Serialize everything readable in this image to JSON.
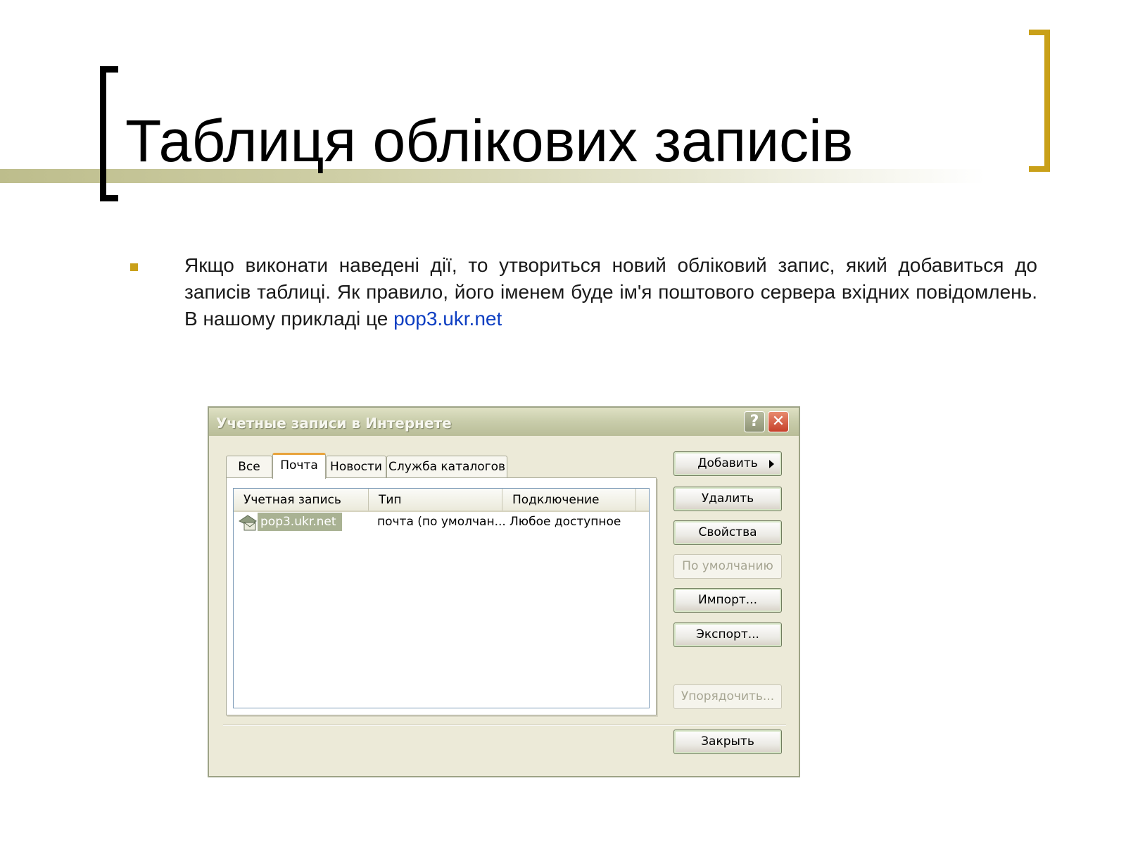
{
  "slide": {
    "title": "Таблиця облікових записів",
    "bullet_text": "Якщо виконати наведені дії, то утвориться новий обліковий запис, який добавиться до записів таблиці. Як правило, його іменем буде ім'я поштового сервера вхідних повідомлень. В нашому прикладі це ",
    "bullet_link": "pop3.ukr.net",
    "colors": {
      "accent": "#c9a019",
      "band": "#bdbd8c",
      "link": "#0d3ec2"
    }
  },
  "dialog": {
    "title": "Учетные записи в Интернете",
    "help_label": "?",
    "close_label": "✕",
    "tabs": [
      "Все",
      "Почта",
      "Новости",
      "Служба каталогов"
    ],
    "active_tab": "Почта",
    "columns": [
      "Учетная запись",
      "Тип",
      "Подключение"
    ],
    "rows": [
      {
        "account": "pop3.ukr.net",
        "type": "почта (по умолчан...",
        "connection": "Любое доступное",
        "icon": "mail-account-icon",
        "selected": true
      }
    ],
    "buttons": {
      "add": "Добавить",
      "delete": "Удалить",
      "properties": "Свойства",
      "set_default": "По умолчанию",
      "import": "Импорт...",
      "export": "Экспорт...",
      "order": "Упорядочить...",
      "close": "Закрыть"
    }
  }
}
